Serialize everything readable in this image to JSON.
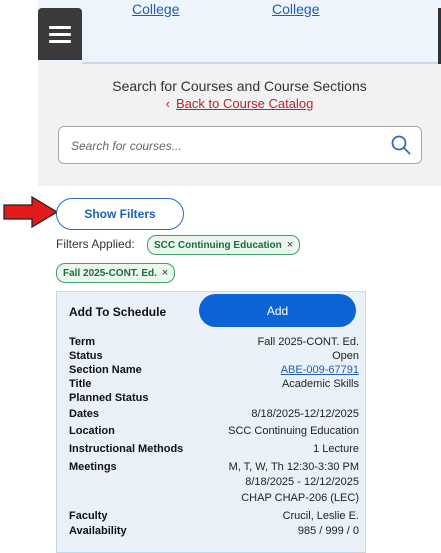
{
  "header": {
    "college_links": [
      "College",
      "College"
    ]
  },
  "search": {
    "heading": "Search for Courses and Course Sections",
    "back_link": "Back to Course Catalog",
    "placeholder": "Search for courses..."
  },
  "filters": {
    "show_button": "Show Filters",
    "applied_label": "Filters Applied:",
    "chips": [
      "SCC Continuing Education",
      "Fall 2025-CONT. Ed."
    ],
    "remove_glyph": "×"
  },
  "section": {
    "add_to_schedule": "Add To Schedule",
    "add_button": "Add",
    "fields": {
      "term": {
        "label": "Term",
        "value": "Fall 2025-CONT. Ed."
      },
      "status": {
        "label": "Status",
        "value": "Open"
      },
      "section_name": {
        "label": "Section Name",
        "value": "ABE-009-67791"
      },
      "title": {
        "label": "Title",
        "value": "Academic Skills"
      },
      "planned_status": {
        "label": "Planned Status",
        "value": ""
      },
      "dates": {
        "label": "Dates",
        "value": "8/18/2025-12/12/2025"
      },
      "location": {
        "label": "Location",
        "value": "SCC Continuing Education"
      },
      "instructional_methods": {
        "label": "Instructional Methods",
        "value": "1 Lecture"
      },
      "meetings": {
        "label": "Meetings",
        "lines": [
          "M, T, W, Th 12:30-3:30 PM",
          "8/18/2025 - 12/12/2025",
          "CHAP CHAP-206 (LEC)"
        ]
      },
      "faculty": {
        "label": "Faculty",
        "value": "Crucil, Leslie E."
      },
      "availability": {
        "label": "Availability",
        "value": "985 / 999 / 0"
      }
    }
  },
  "colors": {
    "accent": "#0b63d6",
    "link": "#1f5fb5",
    "back_link": "#b4282a",
    "chip_border": "#3fa064",
    "arrow": "#e31b1b"
  }
}
